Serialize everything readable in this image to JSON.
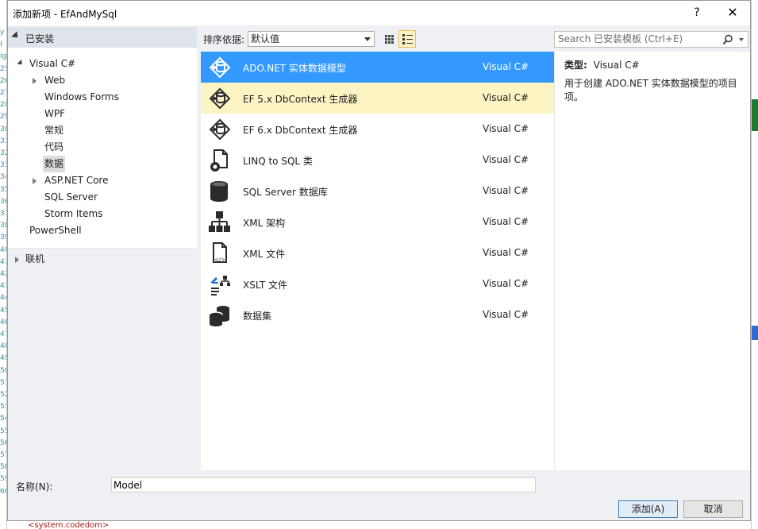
{
  "window": {
    "title": "添加新项 - EfAndMySql",
    "help_glyph": "?",
    "close_glyph": "✕"
  },
  "tree": {
    "header": "已安装",
    "nodes": [
      {
        "label": "Visual C#",
        "level": 0,
        "expander": "open"
      },
      {
        "label": "Web",
        "level": 1,
        "expander": "closed"
      },
      {
        "label": "Windows Forms",
        "level": 1,
        "expander": "none"
      },
      {
        "label": "WPF",
        "level": 1,
        "expander": "none"
      },
      {
        "label": "常规",
        "level": 1,
        "expander": "none"
      },
      {
        "label": "代码",
        "level": 1,
        "expander": "none"
      },
      {
        "label": "数据",
        "level": 1,
        "expander": "none",
        "selected": true
      },
      {
        "label": "ASP.NET Core",
        "level": 1,
        "expander": "closed"
      },
      {
        "label": "SQL Server",
        "level": 1,
        "expander": "none"
      },
      {
        "label": "Storm Items",
        "level": 1,
        "expander": "none"
      },
      {
        "label": "PowerShell",
        "level": 0,
        "expander": "none"
      }
    ],
    "online": "联机"
  },
  "toolbar": {
    "sort_label": "排序依据:",
    "sort_value": "默认值",
    "search_placeholder": "Search 已安装模板 (Ctrl+E)"
  },
  "templates": [
    {
      "name": "ADO.NET 实体数据模型",
      "lang": "Visual C#",
      "icon": "entity-model-icon",
      "state": "selected"
    },
    {
      "name": "EF 5.x DbContext 生成器",
      "lang": "Visual C#",
      "icon": "dbcontext-generator-icon",
      "state": "hover"
    },
    {
      "name": "EF 6.x DbContext 生成器",
      "lang": "Visual C#",
      "icon": "dbcontext-generator-icon",
      "state": "normal"
    },
    {
      "name": "LINQ to SQL 类",
      "lang": "Visual C#",
      "icon": "linq-to-sql-icon",
      "state": "normal"
    },
    {
      "name": "SQL Server 数据库",
      "lang": "Visual C#",
      "icon": "database-icon",
      "state": "normal"
    },
    {
      "name": "XML 架构",
      "lang": "Visual C#",
      "icon": "xml-schema-icon",
      "state": "normal"
    },
    {
      "name": "XML 文件",
      "lang": "Visual C#",
      "icon": "xml-file-icon",
      "state": "normal"
    },
    {
      "name": "XSLT 文件",
      "lang": "Visual C#",
      "icon": "xslt-file-icon",
      "state": "normal"
    },
    {
      "name": "数据集",
      "lang": "Visual C#",
      "icon": "dataset-icon",
      "state": "normal"
    }
  ],
  "description": {
    "type_label": "类型:",
    "type_value": "Visual C#",
    "text": "用于创建 ADO.NET 实体数据模型的项目项。"
  },
  "name_field": {
    "label": "名称(N):",
    "value": "Model"
  },
  "buttons": {
    "add": "添加(A)",
    "cancel": "取消"
  },
  "background": {
    "line_numbers": [
      "y",
      "(",
      "ig",
      "25",
      "26",
      "27",
      "28",
      "29",
      "30",
      "31",
      "32",
      "33",
      "34",
      "35",
      "36",
      "37",
      "38",
      "39",
      "40",
      "41",
      "42",
      "43",
      "44",
      "45",
      "46",
      "47",
      "48",
      "49",
      "50",
      "51",
      "52",
      "53",
      "54",
      "55",
      "56",
      "57",
      "58",
      "59",
      "60"
    ],
    "bottom_text": "<system.codedom>"
  },
  "colors": {
    "selection": "#3399ff",
    "hover": "#fdf4c4",
    "accent_border": "#3c7fb1"
  }
}
